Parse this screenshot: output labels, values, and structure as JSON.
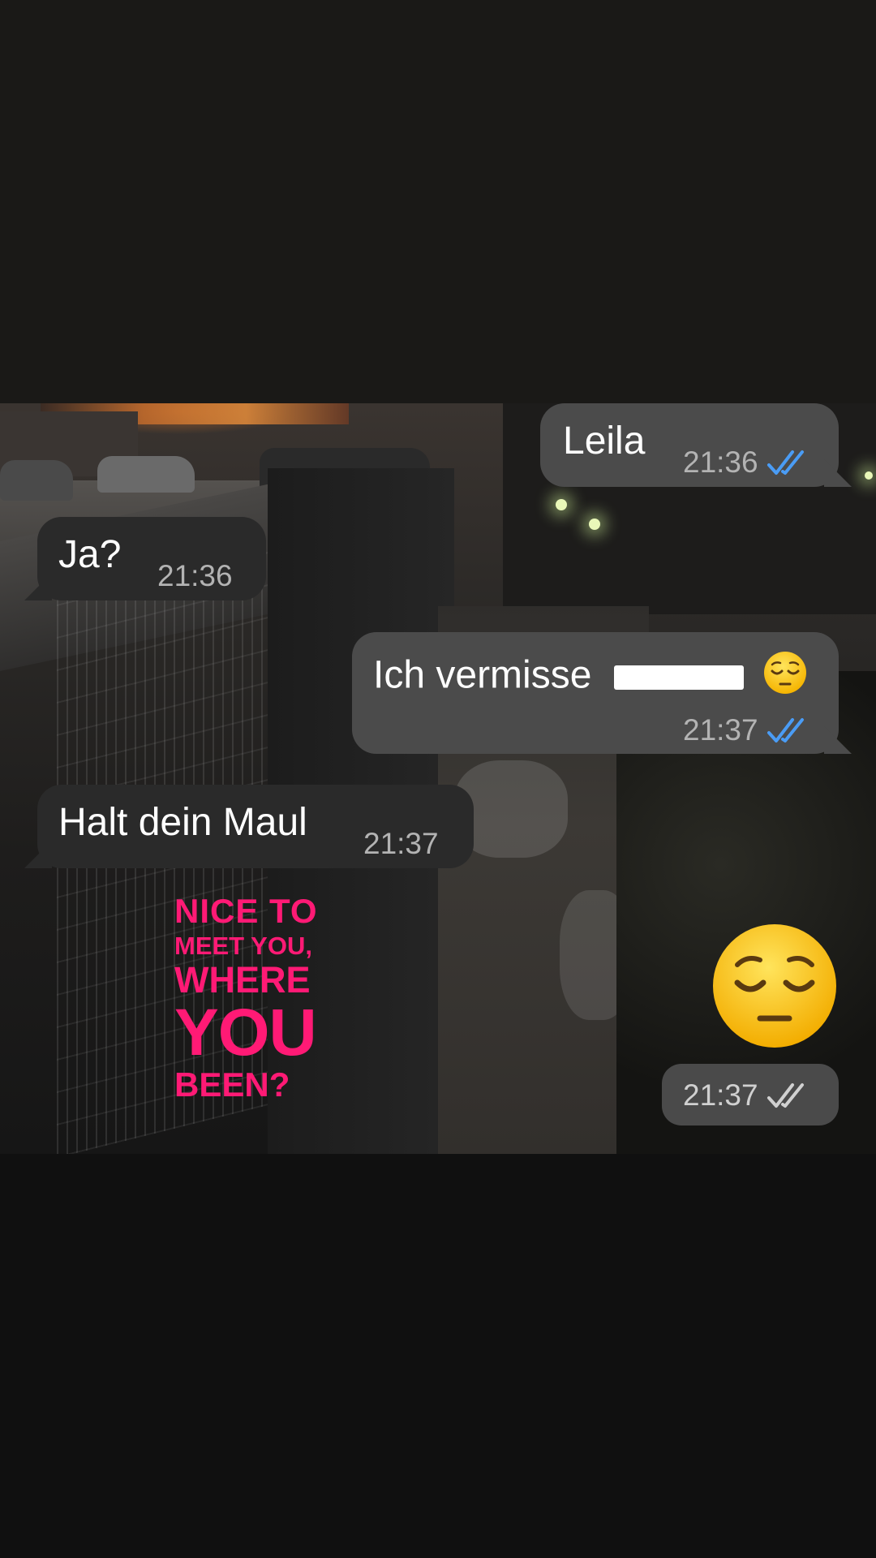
{
  "messages": [
    {
      "direction": "outgoing",
      "text": "Leila",
      "time": "21:36",
      "status": "read"
    },
    {
      "direction": "incoming",
      "text": "Ja?",
      "time": "21:36"
    },
    {
      "direction": "outgoing",
      "text": "Ich vermisse",
      "redacted": true,
      "emoji": "😔",
      "time": "21:37",
      "status": "read"
    },
    {
      "direction": "incoming",
      "text": "Halt dein Maul",
      "time": "21:37"
    }
  ],
  "sticker": {
    "line1": "NICE TO",
    "line2": "MEET YOU,",
    "line3": "WHERE",
    "line4": "YOU",
    "line5": "BEEN?",
    "color": "#ff1a75"
  },
  "emoji_message": {
    "emoji": "😔",
    "time": "21:37",
    "status": "delivered"
  },
  "colors": {
    "outgoing_bubble": "#4b4b4b",
    "incoming_bubble": "#2a2a2a",
    "read_tick": "#4a9cf5",
    "delivered_tick": "#d0d0d0"
  }
}
